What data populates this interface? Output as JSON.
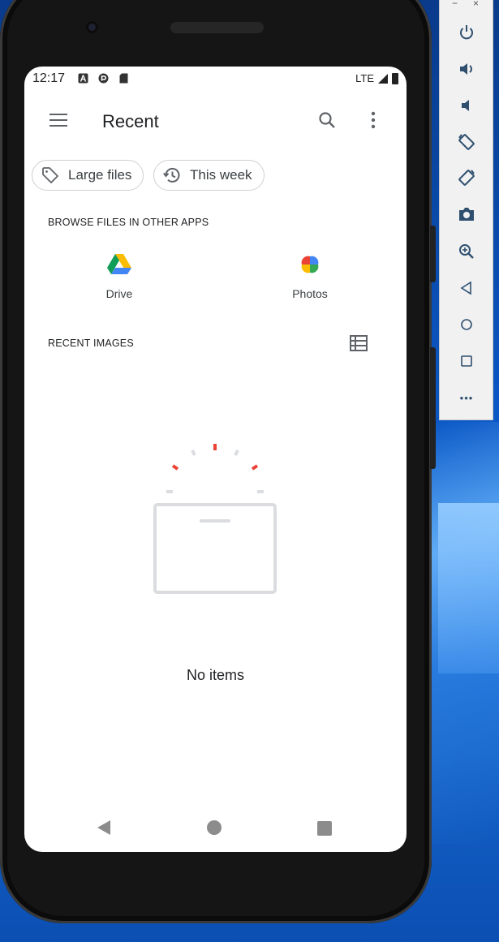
{
  "status_bar": {
    "time": "12:17",
    "network": "LTE"
  },
  "app_bar": {
    "title": "Recent",
    "icons": [
      "menu-icon",
      "search-icon",
      "more-vert-icon"
    ]
  },
  "filter_chips": [
    {
      "label": "Large files",
      "icon": "tag-icon"
    },
    {
      "label": "This week",
      "icon": "history-icon"
    }
  ],
  "browse_section": {
    "title": "BROWSE FILES IN OTHER APPS",
    "apps": [
      {
        "label": "Drive",
        "icon": "google-drive-icon"
      },
      {
        "label": "Photos",
        "icon": "google-photos-icon"
      }
    ]
  },
  "recent_images": {
    "title": "RECENT IMAGES",
    "view_icon": "list-view-icon",
    "empty_text": "No items"
  },
  "nav_bar": {
    "icons": [
      "back-icon",
      "home-icon",
      "recents-icon"
    ]
  },
  "emulator_toolbar": {
    "window_buttons": {
      "minimize": "−",
      "close": "×"
    },
    "buttons": [
      "power-icon",
      "volume-up-icon",
      "volume-down-icon",
      "rotate-left-icon",
      "rotate-right-icon",
      "camera-icon",
      "zoom-icon",
      "back-icon",
      "home-icon",
      "overview-icon",
      "more-icon"
    ],
    "more_label": "•••"
  },
  "colors": {
    "accent_red": "#ea4335",
    "text_primary": "#202124",
    "icon_grey": "#5f6368",
    "desktop_blue": "#0b58c6"
  }
}
